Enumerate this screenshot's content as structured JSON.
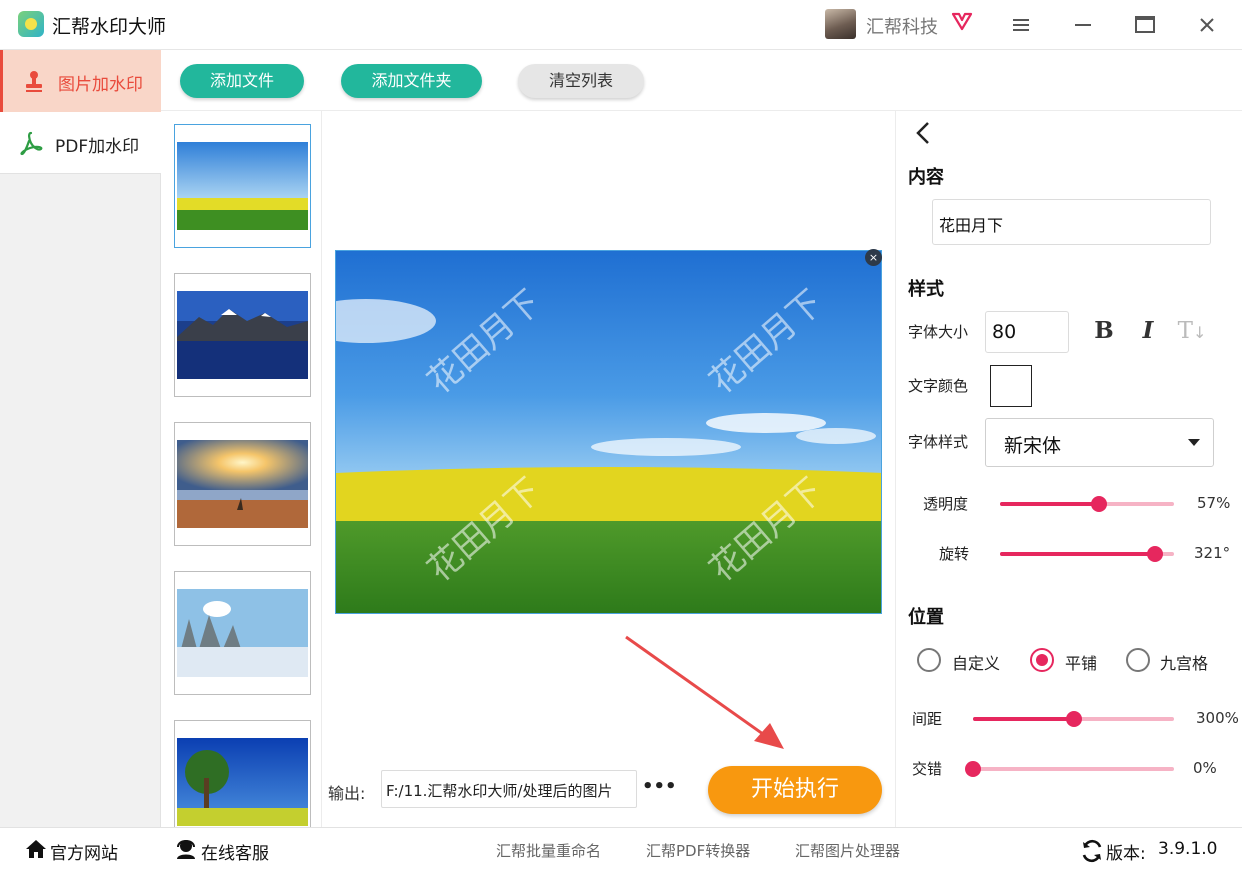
{
  "app": {
    "title": "汇帮水印大师"
  },
  "user": {
    "name": "汇帮科技"
  },
  "sidebar": {
    "items": [
      {
        "label": "图片加水印",
        "active": true
      },
      {
        "label": "PDF加水印",
        "active": false
      }
    ]
  },
  "toolbar": {
    "add_file": "添加文件",
    "add_folder": "添加文件夹",
    "clear_list": "清空列表"
  },
  "thumbnails": [
    {
      "name": "field-sky",
      "selected": true
    },
    {
      "name": "mountain-lake",
      "selected": false
    },
    {
      "name": "beach-sunset",
      "selected": false
    },
    {
      "name": "winter-trees",
      "selected": false
    },
    {
      "name": "tree-meadow",
      "selected": false
    }
  ],
  "preview": {
    "watermark_text": "花田月下",
    "close": "×"
  },
  "output": {
    "label": "输出:",
    "path": "F:/11.汇帮水印大师/处理后的图片",
    "more": "•••"
  },
  "actions": {
    "start": "开始执行"
  },
  "settings": {
    "content": {
      "title": "内容",
      "value": "花田月下"
    },
    "style": {
      "title": "样式",
      "font_size_label": "字体大小",
      "font_size_value": "80",
      "bold": "B",
      "italic": "I",
      "strike_label": "T",
      "text_color_label": "文字颜色",
      "text_color": "#ffffff",
      "font_style_label": "字体样式",
      "font_value": "新宋体",
      "opacity_label": "透明度",
      "opacity_value": "57%",
      "opacity_fraction": 0.57,
      "rotation_label": "旋转",
      "rotation_value": "321°",
      "rotation_fraction": 0.89
    },
    "position": {
      "title": "位置",
      "options": [
        {
          "label": "自定义",
          "checked": false
        },
        {
          "label": "平铺",
          "checked": true
        },
        {
          "label": "九宫格",
          "checked": false
        }
      ],
      "spacing_label": "间距",
      "spacing_value": "300%",
      "spacing_fraction": 0.5,
      "stagger_label": "交错",
      "stagger_value": "0%",
      "stagger_fraction": 0.0
    }
  },
  "footer": {
    "website": "官方网站",
    "support": "在线客服",
    "tools": [
      "汇帮批量重命名",
      "汇帮PDF转换器",
      "汇帮图片处理器"
    ],
    "version_label": "版本:",
    "version_value": "3.9.1.0"
  },
  "colors": {
    "accent": "#e6275e",
    "teal_button": "#22b79c",
    "start_button": "#f8980f",
    "sidebar_active_bg": "#f9d6c8",
    "sidebar_active_text": "#e94b3c"
  }
}
